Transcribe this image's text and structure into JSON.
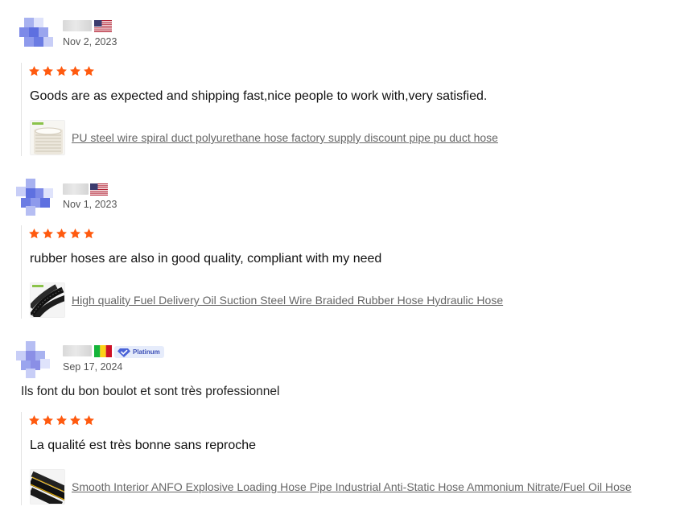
{
  "reviews": [
    {
      "date": "Nov 2, 2023",
      "flag_icon": "us-flag-icon",
      "stars": 5,
      "star_color": "#ff5a0f",
      "comment": "Goods are as expected and shipping fast,nice people to work with,very satisfied.",
      "product_link": "PU steel wire spiral duct polyurethane hose factory supply discount pipe pu duct hose",
      "avatar_color": "#5e70e0"
    },
    {
      "date": "Nov 1, 2023",
      "flag_icon": "us-flag-icon",
      "stars": 5,
      "star_color": "#ff5a0f",
      "comment": "rubber hoses are also in good quality, compliant with my need",
      "product_link": "High quality Fuel Delivery Oil Suction Steel Wire Braided Rubber Hose Hydraulic Hose",
      "avatar_color": "#5e70e0"
    },
    {
      "date": "Sep 17, 2024",
      "flag_icon": "mali-flag-icon",
      "badge": "Platinum",
      "buyer_comment": "Ils font du bon boulot et sont très professionnel",
      "stars": 5,
      "star_color": "#ff5a0f",
      "comment": "La qualité est très bonne sans reproche",
      "product_link": "Smooth Interior ANFO Explosive Loading Hose Pipe Industrial Anti-Static Hose Ammonium Nitrate/Fuel Oil Hose",
      "avatar_color": "#8a8fe6"
    }
  ]
}
